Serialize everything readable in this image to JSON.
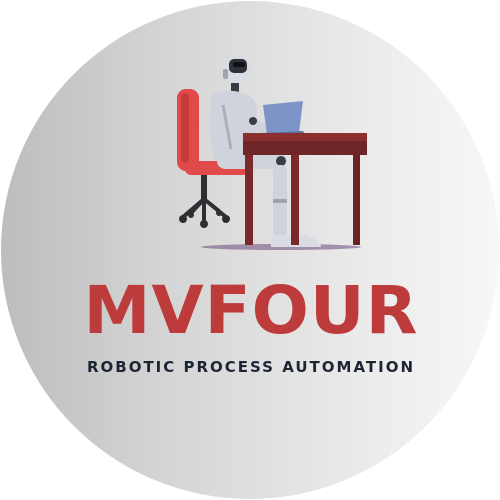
{
  "brand": {
    "name": "MVFOUR",
    "tagline": "ROBOTIC PROCESS AUTOMATION"
  },
  "colors": {
    "brand_red": "#bd3b3b",
    "tagline_navy": "#1d2433",
    "chair_red": "#e04a4a",
    "desk_brown": "#7a2a2a",
    "laptop_blue": "#7c94c8"
  },
  "icons": [
    "robot-at-desk-illustration"
  ]
}
